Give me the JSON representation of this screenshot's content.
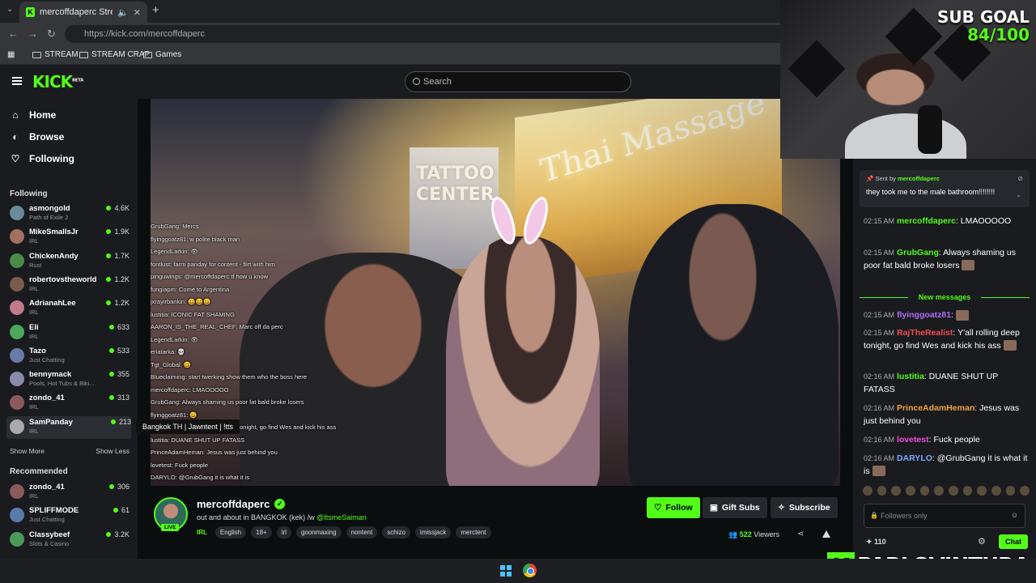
{
  "browser": {
    "tab_title": "mercoffdaperc Stream - W",
    "url": "https://kick.com/mercoffdaperc",
    "bookmarks": [
      "STREAM",
      "STREAM CRAP",
      "Games"
    ]
  },
  "header": {
    "logo": "KICK",
    "logo_badge": "BETA",
    "search_placeholder": "Search"
  },
  "sidebar": {
    "nav": [
      {
        "label": "Home",
        "icon": "home-icon"
      },
      {
        "label": "Browse",
        "icon": "browse-icon"
      },
      {
        "label": "Following",
        "icon": "heart-icon"
      }
    ],
    "following_title": "Following",
    "following": [
      {
        "name": "asmongold",
        "category": "Path of Exile 2",
        "viewers": "4.6K",
        "color": "#6a8a9a"
      },
      {
        "name": "MikeSmallsJr",
        "category": "IRL",
        "viewers": "1.9K",
        "color": "#a07060"
      },
      {
        "name": "ChickenAndy",
        "category": "Rust",
        "viewers": "1.7K",
        "color": "#4a8a4a"
      },
      {
        "name": "robertovstheworld",
        "category": "IRL",
        "viewers": "1.2K",
        "color": "#7a5a4a"
      },
      {
        "name": "AdrianahLee",
        "category": "IRL",
        "viewers": "1.2K",
        "color": "#c07a8a"
      },
      {
        "name": "Eli",
        "category": "IRL",
        "viewers": "633",
        "color": "#4aaa5a"
      },
      {
        "name": "Tazo",
        "category": "Just Chatting",
        "viewers": "533",
        "color": "#6a7aaa"
      },
      {
        "name": "bennymack",
        "category": "Pools, Hot Tubs & Biki...",
        "viewers": "355",
        "color": "#8a8aaa"
      },
      {
        "name": "zondo_41",
        "category": "IRL",
        "viewers": "313",
        "color": "#8a5a5a"
      },
      {
        "name": "SamPanday",
        "category": "IRL",
        "viewers": "213",
        "color": "#aaaaaa"
      }
    ],
    "show_more": "Show More",
    "show_less": "Show Less",
    "recommended_title": "Recommended",
    "recommended": [
      {
        "name": "zondo_41",
        "category": "IRL",
        "viewers": "306",
        "color": "#8a5a5a"
      },
      {
        "name": "SPLIFFMODE",
        "category": "Just Chatting",
        "viewers": "61",
        "color": "#5a7aaa"
      },
      {
        "name": "Classybeef",
        "category": "Slots & Casino",
        "viewers": "3.2K",
        "color": "#4a9a5a"
      }
    ],
    "tooltip": "Bangkok TH | Jawntent | !tts"
  },
  "video": {
    "sign_massage": "Thai Massage",
    "sign_tattoo": "TATTOO CENTER",
    "overlay_chat": [
      "GrubGang: Mercs",
      "flyinggoatz81: w polite black man",
      "LegendLarkin: 👁",
      "fontlust: farm panday for content - flirt with him",
      "pinguwings: @mercoffdaperc tf how u know",
      "fungiapm: Come to Argentina",
      "jxrayirbankin: 😀😀😀",
      "lustitia: ICONIC FAT SHAMING",
      "AARON_IS_THE_REAL_CHEF: Marc off da perc",
      "LegendLarkin: 👁",
      "eriatarka: 💀",
      "Tgt_Global: 😀",
      "Blueclaiming: start twerking show them who the boss here",
      "mercoffdaperc: LMAOOOOO",
      "GrubGang: Always shaming us poor fat bald broke losers",
      "flyinggoatz81: 😀",
      "RajTheRealist: Y'all rolling deep tonight, go find Wes and kick his ass",
      "lustitia: DUANE SHUT UP FATASS",
      "PrinceAdamHeman: Jesus was just behind you",
      "lovetest: Fuck people",
      "DARYLO: @GrubGang it is what it is"
    ]
  },
  "stream": {
    "channel": "mercoffdaperc",
    "live": "LIVE",
    "title_prefix": "out and about in BANGKOK (kek) /w ",
    "title_mention": "@ItsmeSaiman",
    "category": "IRL",
    "tags": [
      "English",
      "18+",
      "lrl",
      "goonmaxing",
      "nontent",
      "schizo",
      "imissjack",
      "merctent"
    ],
    "follow": "Follow",
    "gift_subs": "Gift Subs",
    "subscribe": "Subscribe",
    "viewers": "522",
    "viewers_label": "Viewers"
  },
  "cam": {
    "sub_goal_label": "SUB GOAL",
    "sub_goal_value": "84/100"
  },
  "chat": {
    "pinned": {
      "sent_by": "Sent by",
      "user": "mercoffdaperc",
      "message": "they took me to the male bathroom!!!!!!!!"
    },
    "messages": [
      {
        "time": "02:15 AM",
        "user": "mercoffdaperc",
        "color": "#53fc18",
        "text": "LMAOOOOO"
      },
      {
        "time": "02:15 AM",
        "user": "GrubGang",
        "color": "#53fc18",
        "text": "Always shaming us poor fat bald broke losers"
      }
    ],
    "new_messages": "New messages",
    "messages2": [
      {
        "time": "02:15 AM",
        "user": "flyinggoatz81",
        "color": "#b16cf7",
        "text": ""
      },
      {
        "time": "02:15 AM",
        "user": "RajTheRealist",
        "color": "#f24e4e",
        "text": "Y'all rolling deep tonight, go find Wes and kick his ass"
      },
      {
        "time": "02:16 AM",
        "user": "lustitia",
        "color": "#53fc18",
        "text": "DUANE SHUT UP FATASS"
      },
      {
        "time": "02:16 AM",
        "user": "PrinceAdamHeman",
        "color": "#f2a33a",
        "text": "Jesus was just behind you"
      },
      {
        "time": "02:16 AM",
        "user": "lovetest",
        "color": "#f24eda",
        "text": "Fuck people"
      },
      {
        "time": "02:16 AM",
        "user": "DARYLO",
        "color": "#7aa8ff",
        "text": "@GrubGang it is what it is"
      }
    ],
    "input_placeholder": "Followers only",
    "points": "110",
    "chat_button": "Chat"
  },
  "watermark": {
    "letter": "K",
    "name": "PABLOVINTURA"
  }
}
